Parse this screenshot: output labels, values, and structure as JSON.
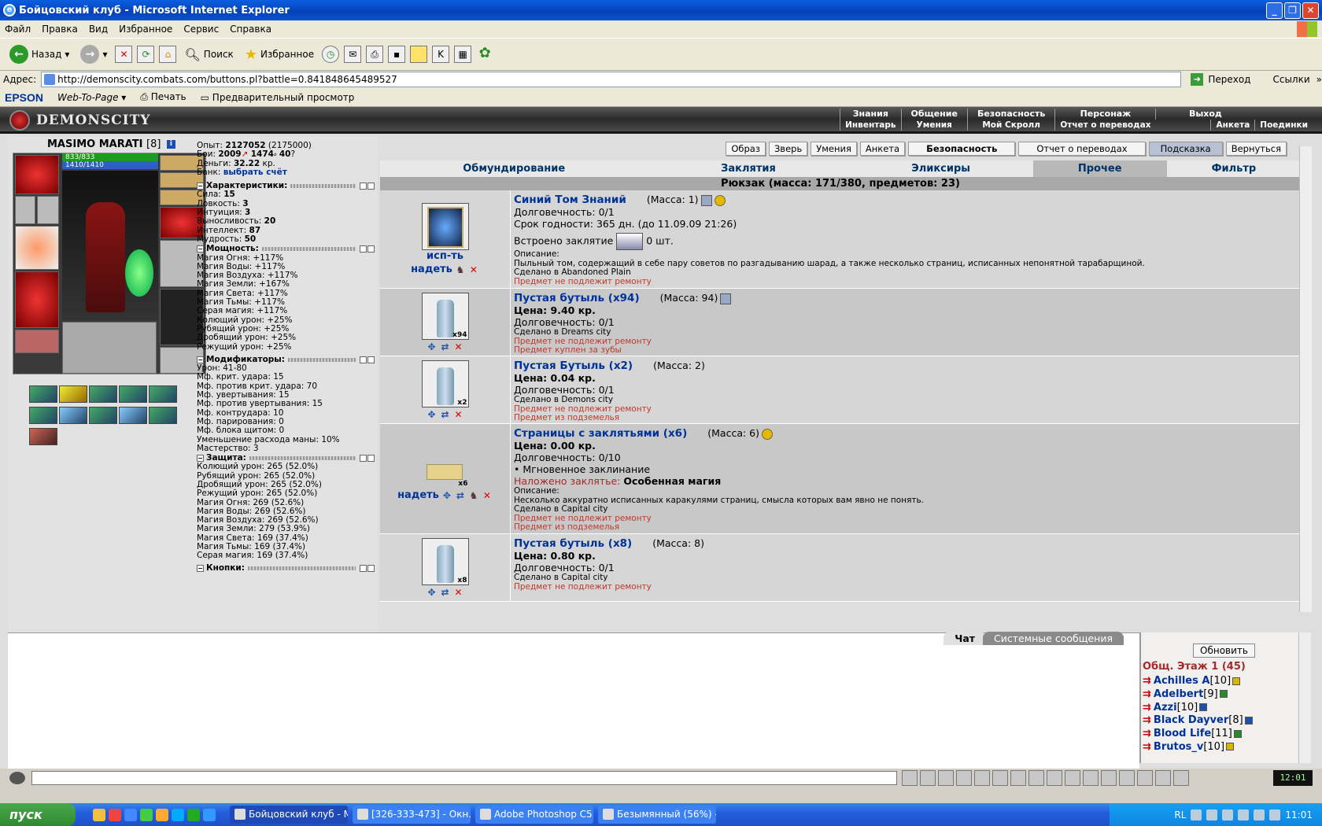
{
  "window": {
    "title": "Бойцовский клуб - Microsoft Internet Explorer"
  },
  "menu": [
    "Файл",
    "Правка",
    "Вид",
    "Избранное",
    "Сервис",
    "Справка"
  ],
  "toolbar": {
    "back": "Назад",
    "search": "Поиск",
    "favorites": "Избранное"
  },
  "address": {
    "label": "Адрес:",
    "url": "http://demonscity.combats.com/buttons.pl?battle=0.841848645489527",
    "go": "Переход",
    "links": "Ссылки"
  },
  "epson": {
    "brand": "EPSON",
    "w2p": "Web-To-Page",
    "print": "Печать",
    "preview": "Предварительный просмотр"
  },
  "game": {
    "logo": "DEMONSCITY",
    "topnav_row1": [
      "Знания",
      "Общение",
      "Безопасность",
      "Персонаж",
      "Выход"
    ],
    "topnav_row2": [
      "Инвентарь",
      "Умения",
      "Мой Скролл",
      "Отчет о переводах",
      "Поединки",
      "Анкета"
    ]
  },
  "player": {
    "name": "MASIMO MARATI",
    "level": "[8]",
    "hp": "833/833",
    "mp": "1410/1410",
    "exp_label": "Опыт:",
    "exp": "2127052",
    "exp_next": "(2175000)",
    "battles_label": "Бои:",
    "battles": "2009",
    "wins": "1474",
    "losses": "40",
    "money_label": "Деньги:",
    "money": "32.22",
    "money_unit": "кр.",
    "bank_label": "Банк:",
    "bank_link": "выбрать счёт"
  },
  "sections": {
    "chars": "Характеристики:",
    "power": "Мощность:",
    "mods": "Модификаторы:",
    "defense": "Защита:",
    "buttons": "Кнопки:"
  },
  "characteristics": [
    {
      "label": "Сила:",
      "value": "15"
    },
    {
      "label": "Ловкость:",
      "value": "3"
    },
    {
      "label": "Интуиция:",
      "value": "3"
    },
    {
      "label": "Выносливость:",
      "value": "20"
    },
    {
      "label": "Интеллект:",
      "value": "87"
    },
    {
      "label": "Мудрость:",
      "value": "50"
    }
  ],
  "power": [
    "Магия Огня: +117%",
    "Магия Воды: +117%",
    "Магия Воздуха: +117%",
    "Магия Земли: +167%",
    "Магия Света: +117%",
    "Магия Тьмы: +117%",
    "Серая магия: +117%",
    "Колющий урон: +25%",
    "Рубящий урон: +25%",
    "Дробящий урон: +25%",
    "Режущий урон: +25%"
  ],
  "modifiers": [
    "Урон: 41-80",
    "Мф. крит. удара: 15",
    "Мф. против крит. удара: 70",
    "Мф. увертывания: 15",
    "Мф. против увертывания: 15",
    "Мф. контрудара: 10",
    "Мф. парирования: 0",
    "Мф. блока щитом: 0",
    "Уменьшение расхода маны: 10%",
    "Мастерство: 3"
  ],
  "defense": [
    "Колющий урон: 265 (52.0%)",
    "Рубящий урон: 265 (52.0%)",
    "Дробящий урон: 265 (52.0%)",
    "Режущий урон: 265 (52.0%)",
    "Магия Огня: 269 (52.6%)",
    "Магия Воды: 269 (52.6%)",
    "Магия Воздуха: 269 (52.6%)",
    "Магия Земли: 279 (53.9%)",
    "Магия Света: 169 (37.4%)",
    "Магия Тьмы: 169 (37.4%)",
    "Серая магия: 169 (37.4%)"
  ],
  "buttons": [
    "Образ",
    "Зверь",
    "Умения",
    "Анкета",
    "Безопасность",
    "Отчет о переводах",
    "Подсказка",
    "Вернуться"
  ],
  "tabs": [
    "Обмундирование",
    "Заклятия",
    "Эликсиры",
    "Прочее",
    "Фильтр"
  ],
  "sack": "Рюкзак (масса: 171/380, предметов: 23)",
  "items": [
    {
      "name": "Синий Том Знаний",
      "mass": "(Масса: 1)",
      "lines": [
        "Долговечность: 0/1",
        "Срок годности: 365 дн. (до 11.09.09 21:26)"
      ],
      "embed_label": "Встроено заклятие",
      "embed_count": "0 шт.",
      "desc_label": "Описание:",
      "desc": "Пыльный том, содержащий в себе пару советов по разгадыванию шарад, а также несколько страниц, исписанных непонятной тарабарщиной.",
      "made": "Сделано в Abandoned Plain",
      "notes": [
        "Предмет не подлежит ремонту"
      ],
      "use": "исп-ть",
      "wear": "надеть"
    },
    {
      "name": "Пустая бутыль (x94)",
      "mass": "(Масса: 94)",
      "price": "Цена: 9.40 кр.",
      "lines": [
        "Долговечность: 0/1"
      ],
      "made": "Сделано в Dreams city",
      "notes": [
        "Предмет не подлежит ремонту",
        "Предмет куплен за зубы"
      ],
      "count": "x94"
    },
    {
      "name": "Пустая Бутыль (x2)",
      "mass": "(Масса: 2)",
      "price": "Цена: 0.04 кр.",
      "lines": [
        "Долговечность: 0/1"
      ],
      "made": "Сделано в Demons city",
      "notes": [
        "Предмет не подлежит ремонту",
        "Предмет из подземелья"
      ],
      "count": "x2"
    },
    {
      "name": "Страницы с заклятьями (x6)",
      "mass": "(Масса: 6)",
      "price": "Цена: 0.00 кр.",
      "lines": [
        "Долговечность: 0/10",
        "• Мгновенное заклинание"
      ],
      "spell_label": "Наложено заклятье:",
      "spell": "Особенная магия",
      "desc_label": "Описание:",
      "desc": "Несколько аккуратно исписанных каракулями страниц, смысла которых вам явно не понять.",
      "made": "Сделано в Capital city",
      "notes": [
        "Предмет не подлежит ремонту",
        "Предмет из подземелья"
      ],
      "count": "x6",
      "wear": "надеть"
    },
    {
      "name": "Пустая бутыль (x8)",
      "mass": "(Масса: 8)",
      "price": "Цена: 0.80 кр.",
      "lines": [
        "Долговечность: 0/1"
      ],
      "made": "Сделано в Capital city",
      "notes": [
        "Предмет не подлежит ремонту"
      ],
      "count": "x8"
    }
  ],
  "chat": {
    "tab_chat": "Чат",
    "tab_sys": "Системные сообщения"
  },
  "online": {
    "refresh": "Обновить",
    "title": "Общ. Этаж 1 (45)",
    "users": [
      {
        "name": "Achilles A",
        "level": "[10]"
      },
      {
        "name": "Adelbert",
        "level": "[9]"
      },
      {
        "name": "Azzi",
        "level": "[10]"
      },
      {
        "name": "Black Dayver",
        "level": "[8]"
      },
      {
        "name": "Blood Life",
        "level": "[11]"
      },
      {
        "name": "Brutos_v",
        "level": "[10]"
      }
    ]
  },
  "clock": "12:01",
  "taskbar": {
    "start": "пуск",
    "tasks": [
      "Бойцовский клуб - M...",
      "[326-333-473] - Окн...",
      "Adobe Photoshop C5...",
      "Безымянный (56%) -..."
    ],
    "lang": "RL",
    "time": "11:01"
  }
}
